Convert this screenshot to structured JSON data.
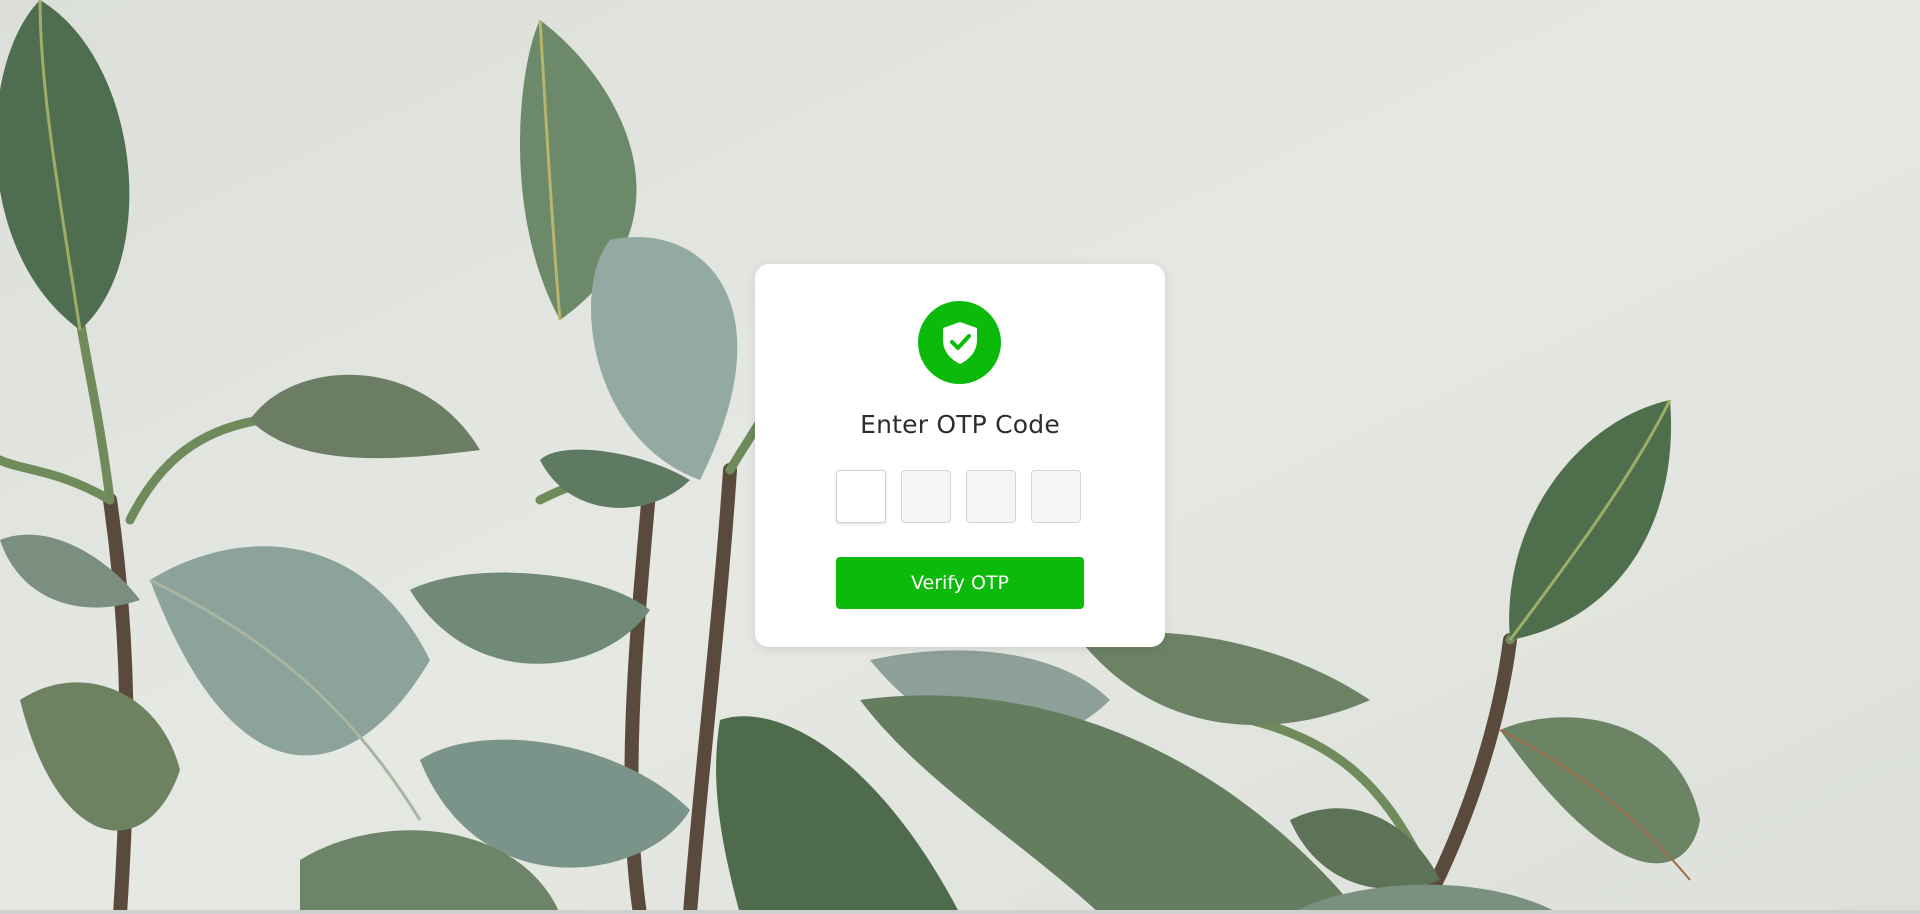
{
  "background": {
    "icon": "rubber-plant-leaves-image",
    "wall_color": "#e3e5e0",
    "leaf_color": "#5f7a63"
  },
  "otp_card": {
    "icon": "shield-check-icon",
    "title": "Enter OTP Code",
    "digits": [
      "",
      "",
      "",
      ""
    ],
    "verify_label": "Verify OTP",
    "accent_color": "#0bba0b"
  }
}
